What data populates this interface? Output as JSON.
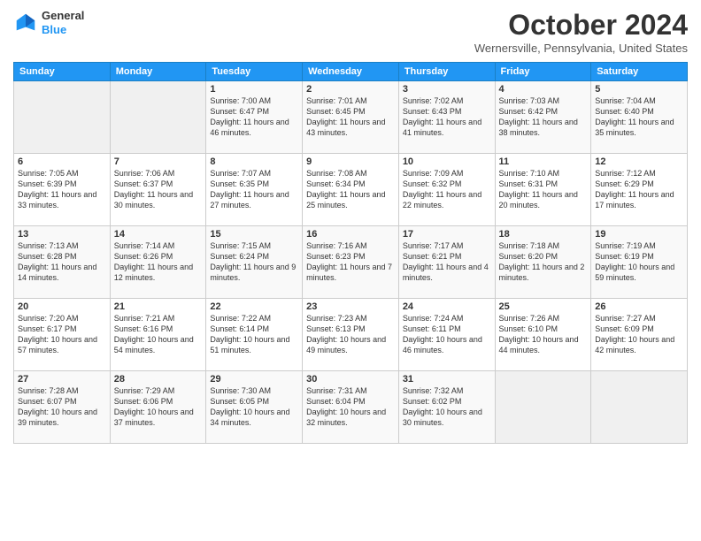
{
  "header": {
    "logo_line1": "General",
    "logo_line2": "Blue",
    "month": "October 2024",
    "location": "Wernersville, Pennsylvania, United States"
  },
  "days_of_week": [
    "Sunday",
    "Monday",
    "Tuesday",
    "Wednesday",
    "Thursday",
    "Friday",
    "Saturday"
  ],
  "weeks": [
    [
      {
        "day": "",
        "detail": ""
      },
      {
        "day": "",
        "detail": ""
      },
      {
        "day": "1",
        "detail": "Sunrise: 7:00 AM\nSunset: 6:47 PM\nDaylight: 11 hours and 46 minutes."
      },
      {
        "day": "2",
        "detail": "Sunrise: 7:01 AM\nSunset: 6:45 PM\nDaylight: 11 hours and 43 minutes."
      },
      {
        "day": "3",
        "detail": "Sunrise: 7:02 AM\nSunset: 6:43 PM\nDaylight: 11 hours and 41 minutes."
      },
      {
        "day": "4",
        "detail": "Sunrise: 7:03 AM\nSunset: 6:42 PM\nDaylight: 11 hours and 38 minutes."
      },
      {
        "day": "5",
        "detail": "Sunrise: 7:04 AM\nSunset: 6:40 PM\nDaylight: 11 hours and 35 minutes."
      }
    ],
    [
      {
        "day": "6",
        "detail": "Sunrise: 7:05 AM\nSunset: 6:39 PM\nDaylight: 11 hours and 33 minutes."
      },
      {
        "day": "7",
        "detail": "Sunrise: 7:06 AM\nSunset: 6:37 PM\nDaylight: 11 hours and 30 minutes."
      },
      {
        "day": "8",
        "detail": "Sunrise: 7:07 AM\nSunset: 6:35 PM\nDaylight: 11 hours and 27 minutes."
      },
      {
        "day": "9",
        "detail": "Sunrise: 7:08 AM\nSunset: 6:34 PM\nDaylight: 11 hours and 25 minutes."
      },
      {
        "day": "10",
        "detail": "Sunrise: 7:09 AM\nSunset: 6:32 PM\nDaylight: 11 hours and 22 minutes."
      },
      {
        "day": "11",
        "detail": "Sunrise: 7:10 AM\nSunset: 6:31 PM\nDaylight: 11 hours and 20 minutes."
      },
      {
        "day": "12",
        "detail": "Sunrise: 7:12 AM\nSunset: 6:29 PM\nDaylight: 11 hours and 17 minutes."
      }
    ],
    [
      {
        "day": "13",
        "detail": "Sunrise: 7:13 AM\nSunset: 6:28 PM\nDaylight: 11 hours and 14 minutes."
      },
      {
        "day": "14",
        "detail": "Sunrise: 7:14 AM\nSunset: 6:26 PM\nDaylight: 11 hours and 12 minutes."
      },
      {
        "day": "15",
        "detail": "Sunrise: 7:15 AM\nSunset: 6:24 PM\nDaylight: 11 hours and 9 minutes."
      },
      {
        "day": "16",
        "detail": "Sunrise: 7:16 AM\nSunset: 6:23 PM\nDaylight: 11 hours and 7 minutes."
      },
      {
        "day": "17",
        "detail": "Sunrise: 7:17 AM\nSunset: 6:21 PM\nDaylight: 11 hours and 4 minutes."
      },
      {
        "day": "18",
        "detail": "Sunrise: 7:18 AM\nSunset: 6:20 PM\nDaylight: 11 hours and 2 minutes."
      },
      {
        "day": "19",
        "detail": "Sunrise: 7:19 AM\nSunset: 6:19 PM\nDaylight: 10 hours and 59 minutes."
      }
    ],
    [
      {
        "day": "20",
        "detail": "Sunrise: 7:20 AM\nSunset: 6:17 PM\nDaylight: 10 hours and 57 minutes."
      },
      {
        "day": "21",
        "detail": "Sunrise: 7:21 AM\nSunset: 6:16 PM\nDaylight: 10 hours and 54 minutes."
      },
      {
        "day": "22",
        "detail": "Sunrise: 7:22 AM\nSunset: 6:14 PM\nDaylight: 10 hours and 51 minutes."
      },
      {
        "day": "23",
        "detail": "Sunrise: 7:23 AM\nSunset: 6:13 PM\nDaylight: 10 hours and 49 minutes."
      },
      {
        "day": "24",
        "detail": "Sunrise: 7:24 AM\nSunset: 6:11 PM\nDaylight: 10 hours and 46 minutes."
      },
      {
        "day": "25",
        "detail": "Sunrise: 7:26 AM\nSunset: 6:10 PM\nDaylight: 10 hours and 44 minutes."
      },
      {
        "day": "26",
        "detail": "Sunrise: 7:27 AM\nSunset: 6:09 PM\nDaylight: 10 hours and 42 minutes."
      }
    ],
    [
      {
        "day": "27",
        "detail": "Sunrise: 7:28 AM\nSunset: 6:07 PM\nDaylight: 10 hours and 39 minutes."
      },
      {
        "day": "28",
        "detail": "Sunrise: 7:29 AM\nSunset: 6:06 PM\nDaylight: 10 hours and 37 minutes."
      },
      {
        "day": "29",
        "detail": "Sunrise: 7:30 AM\nSunset: 6:05 PM\nDaylight: 10 hours and 34 minutes."
      },
      {
        "day": "30",
        "detail": "Sunrise: 7:31 AM\nSunset: 6:04 PM\nDaylight: 10 hours and 32 minutes."
      },
      {
        "day": "31",
        "detail": "Sunrise: 7:32 AM\nSunset: 6:02 PM\nDaylight: 10 hours and 30 minutes."
      },
      {
        "day": "",
        "detail": ""
      },
      {
        "day": "",
        "detail": ""
      }
    ]
  ]
}
